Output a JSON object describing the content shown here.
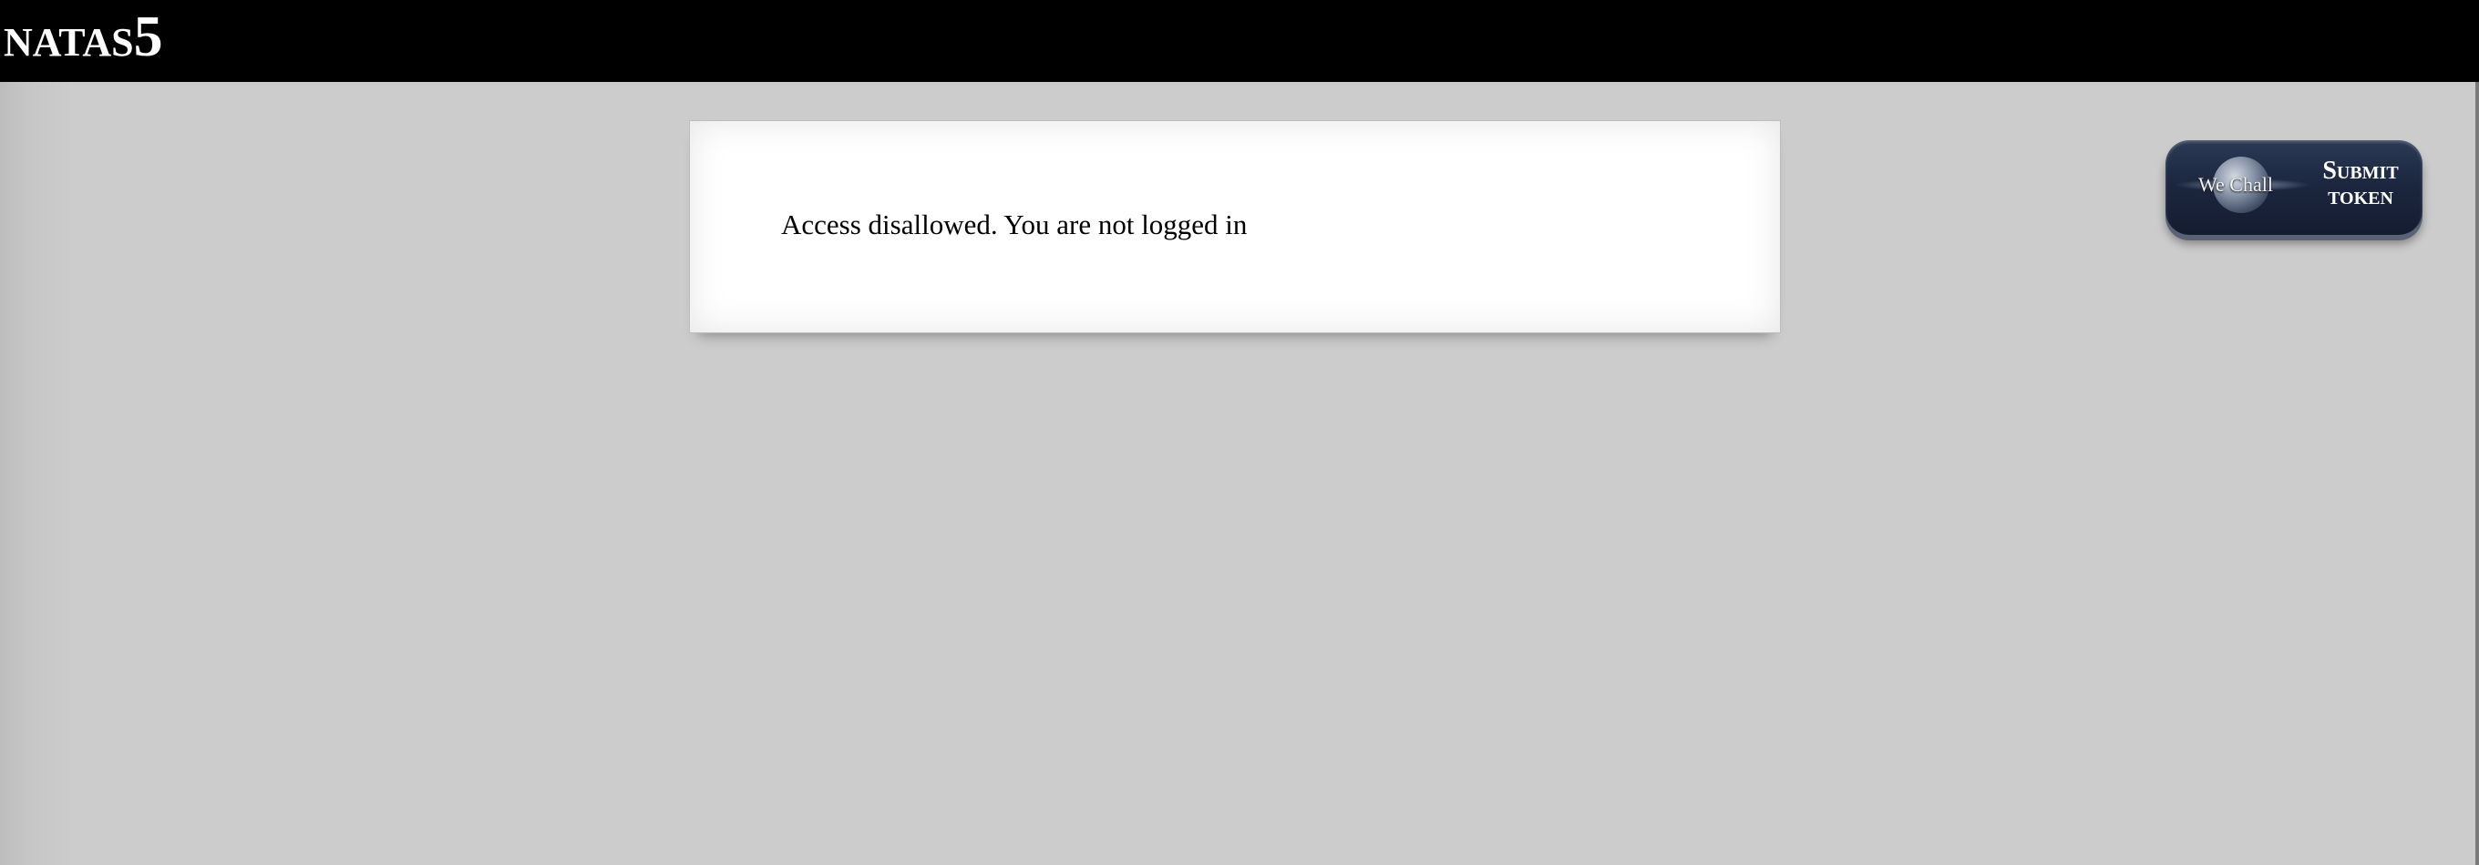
{
  "header": {
    "title_word": "NATAS",
    "title_number": "5"
  },
  "content": {
    "message": "Access disallowed. You are not logged in"
  },
  "wechall_button": {
    "brand": "We Chall",
    "submit": "Submit",
    "token": "TOKEN",
    "icon": "globe-icon",
    "color": "#1c2740"
  },
  "colors": {
    "header_bg": "#000000",
    "page_bg": "#cccccc",
    "content_bg": "#ffffff"
  }
}
